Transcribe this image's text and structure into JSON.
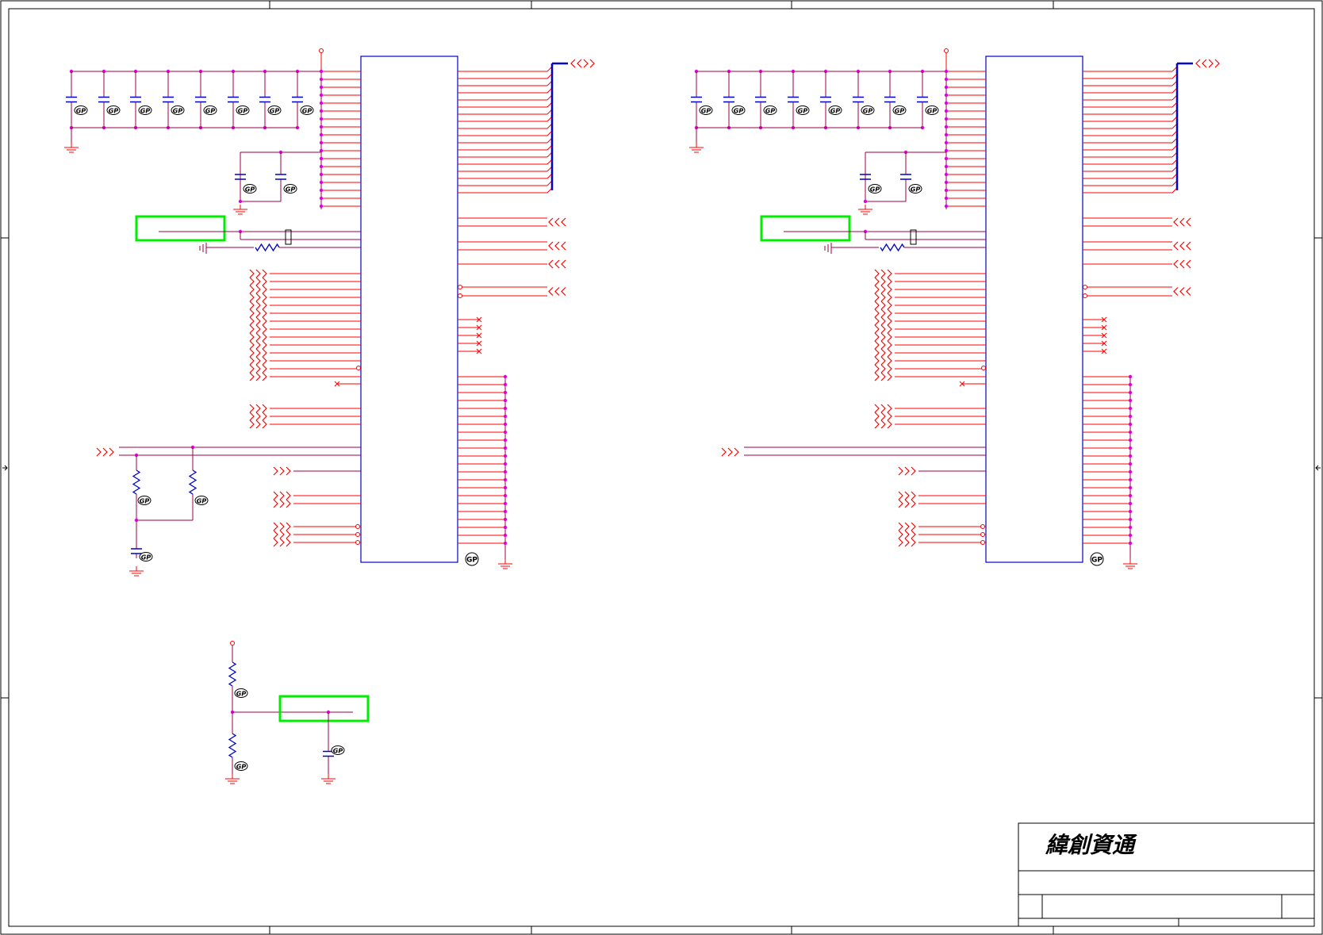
{
  "title_block": {
    "company": "緯創資通"
  },
  "labels": {
    "gnd_tag": "GP",
    "small_tag": "GP"
  },
  "colors": {
    "wire": "#ff0000",
    "net": "#9b0046",
    "component": "#0000cc",
    "junction": "#e000e0",
    "highlight": "#00ee00",
    "frame": "#000000"
  }
}
